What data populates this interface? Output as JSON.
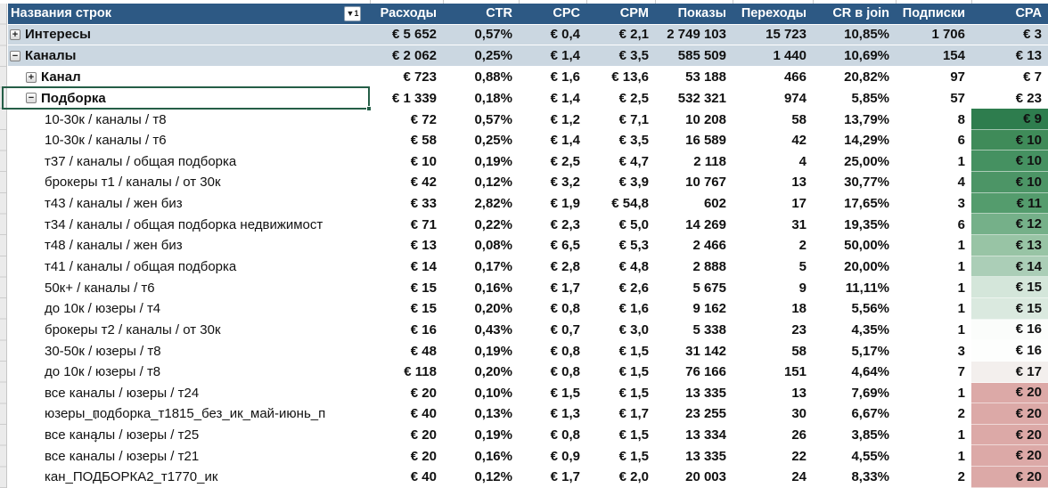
{
  "table": {
    "row_label_header": "Названия строк",
    "sort_badge": "▼1",
    "columns": [
      "Расходы",
      "CTR",
      "CPC",
      "CPM",
      "Показы",
      "Переходы",
      "CR в join",
      "Подписки",
      "CPA"
    ],
    "rows": [
      {
        "label": "Интересы",
        "level": 1,
        "exp": "+",
        "style": "subtotal",
        "values": [
          "€ 5 652",
          "0,57%",
          "€ 0,4",
          "€ 2,1",
          "2 749 103",
          "15 723",
          "10,85%",
          "1 706",
          "€ 3"
        ],
        "cpa_bg": ""
      },
      {
        "label": "Каналы",
        "level": 1,
        "exp": "−",
        "style": "subtotal",
        "values": [
          "€ 2 062",
          "0,25%",
          "€ 1,4",
          "€ 3,5",
          "585 509",
          "1 440",
          "10,69%",
          "154",
          "€ 13"
        ],
        "cpa_bg": ""
      },
      {
        "label": "Канал",
        "level": 2,
        "exp": "+",
        "style": "level2",
        "values": [
          "€ 723",
          "0,88%",
          "€ 1,6",
          "€ 13,6",
          "53 188",
          "466",
          "20,82%",
          "97",
          "€ 7"
        ],
        "cpa_bg": ""
      },
      {
        "label": "Подборка",
        "level": 2,
        "exp": "−",
        "style": "level2",
        "selected": true,
        "values": [
          "€ 1 339",
          "0,18%",
          "€ 1,4",
          "€ 2,5",
          "532 321",
          "974",
          "5,85%",
          "57",
          "€ 23"
        ],
        "cpa_bg": ""
      },
      {
        "label": "10-30к / каналы / т8",
        "level": 3,
        "exp": null,
        "style": "data",
        "values": [
          "€ 72",
          "0,57%",
          "€ 1,2",
          "€ 7,1",
          "10 208",
          "58",
          "13,79%",
          "8",
          "€ 9"
        ],
        "cpa_bg": "#2e7d4e"
      },
      {
        "label": "10-30к / каналы / т6",
        "level": 3,
        "exp": null,
        "style": "data",
        "values": [
          "€ 58",
          "0,25%",
          "€ 1,4",
          "€ 3,5",
          "16 589",
          "42",
          "14,29%",
          "6",
          "€ 10"
        ],
        "cpa_bg": "#3f8b59"
      },
      {
        "label": "т37 / каналы / общая подборка",
        "level": 3,
        "exp": null,
        "style": "data",
        "values": [
          "€ 10",
          "0,19%",
          "€ 2,5",
          "€ 4,7",
          "2 118",
          "4",
          "25,00%",
          "1",
          "€ 10"
        ],
        "cpa_bg": "#459161"
      },
      {
        "label": "брокеры т1 / каналы / от 30к",
        "level": 3,
        "exp": null,
        "style": "data",
        "values": [
          "€ 42",
          "0,12%",
          "€ 3,2",
          "€ 3,9",
          "10 767",
          "13",
          "30,77%",
          "4",
          "€ 10"
        ],
        "cpa_bg": "#4c9566"
      },
      {
        "label": "т43 / каналы / жен биз",
        "level": 3,
        "exp": null,
        "style": "data",
        "values": [
          "€ 33",
          "2,82%",
          "€ 1,9",
          "€ 54,8",
          "602",
          "17",
          "17,65%",
          "3",
          "€ 11"
        ],
        "cpa_bg": "#549c6d"
      },
      {
        "label": "т34 / каналы / общая подборка недвижимост",
        "level": 3,
        "exp": null,
        "style": "data",
        "values": [
          "€ 71",
          "0,22%",
          "€ 2,3",
          "€ 5,0",
          "14 269",
          "31",
          "19,35%",
          "6",
          "€ 12"
        ],
        "cpa_bg": "#75b089"
      },
      {
        "label": "т48 / каналы / жен биз",
        "level": 3,
        "exp": null,
        "style": "data",
        "values": [
          "€ 13",
          "0,08%",
          "€ 6,5",
          "€ 5,3",
          "2 466",
          "2",
          "50,00%",
          "1",
          "€ 13"
        ],
        "cpa_bg": "#98c4a5"
      },
      {
        "label": "т41 / каналы / общая подборка",
        "level": 3,
        "exp": null,
        "style": "data",
        "values": [
          "€ 14",
          "0,17%",
          "€ 2,8",
          "€ 4,8",
          "2 888",
          "5",
          "20,00%",
          "1",
          "€ 14"
        ],
        "cpa_bg": "#abceb7"
      },
      {
        "label": "50к+ / каналы / т6",
        "level": 3,
        "exp": null,
        "style": "data",
        "values": [
          "€ 15",
          "0,16%",
          "€ 1,7",
          "€ 2,6",
          "5 675",
          "9",
          "11,11%",
          "1",
          "€ 15"
        ],
        "cpa_bg": "#d4e6da"
      },
      {
        "label": "до 10к / юзеры / т4",
        "level": 3,
        "exp": null,
        "style": "data",
        "values": [
          "€ 15",
          "0,20%",
          "€ 0,8",
          "€ 1,6",
          "9 162",
          "18",
          "5,56%",
          "1",
          "€ 15"
        ],
        "cpa_bg": "#dae9df"
      },
      {
        "label": "брокеры т2 / каналы / от 30к",
        "level": 3,
        "exp": null,
        "style": "data",
        "values": [
          "€ 16",
          "0,43%",
          "€ 0,7",
          "€ 3,0",
          "5 338",
          "23",
          "4,35%",
          "1",
          "€ 16"
        ],
        "cpa_bg": "#fbfdfb"
      },
      {
        "label": "30-50к / юзеры / т8",
        "level": 3,
        "exp": null,
        "style": "data",
        "values": [
          "€ 48",
          "0,19%",
          "€ 0,8",
          "€ 1,5",
          "31 142",
          "58",
          "5,17%",
          "3",
          "€ 16"
        ],
        "cpa_bg": "#fdfefd"
      },
      {
        "label": "до 10к / юзеры / т8",
        "level": 3,
        "exp": null,
        "style": "data",
        "values": [
          "€ 118",
          "0,20%",
          "€ 0,8",
          "€ 1,5",
          "76 166",
          "151",
          "4,64%",
          "7",
          "€ 17"
        ],
        "cpa_bg": "#f3efed"
      },
      {
        "label": "все каналы / юзеры / т24",
        "level": 3,
        "exp": null,
        "style": "data",
        "values": [
          "€ 20",
          "0,10%",
          "€ 1,5",
          "€ 1,5",
          "13 335",
          "13",
          "7,69%",
          "1",
          "€ 20"
        ],
        "cpa_bg": "#dca9a7"
      },
      {
        "label": "юзеры_подборка_т1815_без_ик_май-июнь_п",
        "level": 3,
        "exp": null,
        "style": "data",
        "values": [
          "€ 40",
          "0,13%",
          "€ 1,3",
          "€ 1,7",
          "23 255",
          "30",
          "6,67%",
          "2",
          "€ 20"
        ],
        "cpa_bg": "#dca9a7"
      },
      {
        "label": "все каналы / юзеры / т25",
        "level": 3,
        "exp": null,
        "style": "data",
        "values": [
          "€ 20",
          "0,19%",
          "€ 0,8",
          "€ 1,5",
          "13 334",
          "26",
          "3,85%",
          "1",
          "€ 20"
        ],
        "cpa_bg": "#dca9a7"
      },
      {
        "label": "все каналы / юзеры / т21",
        "level": 3,
        "exp": null,
        "style": "data",
        "values": [
          "€ 20",
          "0,16%",
          "€ 0,9",
          "€ 1,5",
          "13 335",
          "22",
          "4,55%",
          "1",
          "€ 20"
        ],
        "cpa_bg": "#dca9a7"
      },
      {
        "label": "кан_ПОДБОРКА2_т1770_ик",
        "level": 3,
        "exp": null,
        "style": "data",
        "values": [
          "€ 40",
          "0,12%",
          "€ 1,7",
          "€ 2,0",
          "20 003",
          "24",
          "8,33%",
          "2",
          "€ 20"
        ],
        "cpa_bg": "#dca9a7"
      }
    ]
  },
  "artifacts": {
    "cursor_arrow_1": "↓",
    "cursor_arrow_2": "↓"
  },
  "colors": {
    "header_bg": "#2d5984",
    "subtotal_bg": "#cbd7e1",
    "selection_border": "#255e47",
    "cpa_scale_top": "#2e7d4e",
    "cpa_scale_mid": "#ffffff",
    "cpa_scale_bottom": "#dca9a7"
  }
}
